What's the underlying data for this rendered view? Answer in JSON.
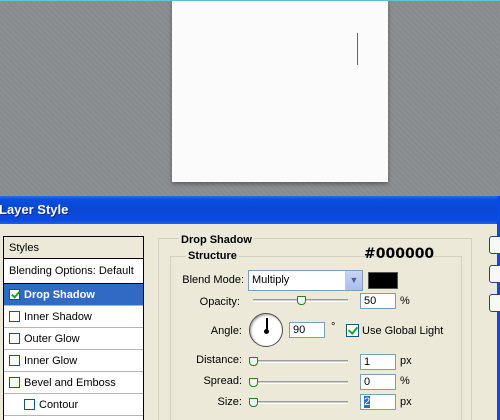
{
  "window": {
    "title": "Layer Style"
  },
  "styles": {
    "header": "Styles",
    "items": [
      {
        "label": "Blending Options: Default",
        "checkbox": false,
        "checked": false,
        "selected": false
      },
      {
        "label": "Drop Shadow",
        "checkbox": true,
        "checked": true,
        "selected": true
      },
      {
        "label": "Inner Shadow",
        "checkbox": true,
        "checked": false,
        "selected": false
      },
      {
        "label": "Outer Glow",
        "checkbox": true,
        "checked": false,
        "selected": false
      },
      {
        "label": "Inner Glow",
        "checkbox": true,
        "checked": false,
        "selected": false
      },
      {
        "label": "Bevel and Emboss",
        "checkbox": true,
        "checked": false,
        "selected": false
      },
      {
        "label": "Contour",
        "checkbox": true,
        "checked": false,
        "selected": false,
        "sub": true
      }
    ]
  },
  "drop_shadow": {
    "group_title": "Drop Shadow",
    "structure_title": "Structure",
    "annotation": "#000000",
    "blend_mode": {
      "label": "Blend Mode:",
      "value": "Multiply"
    },
    "color": "#000000",
    "opacity": {
      "label": "Opacity:",
      "value": "50",
      "unit": "%",
      "level": 0.5
    },
    "angle": {
      "label": "Angle:",
      "value": "90",
      "unit": "°",
      "global_light_label": "Use Global Light",
      "global_light": true
    },
    "distance": {
      "label": "Distance:",
      "value": "1",
      "unit": "px",
      "level": 0.0
    },
    "spread": {
      "label": "Spread:",
      "value": "0",
      "unit": "%",
      "level": 0.0
    },
    "size": {
      "label": "Size:",
      "value": "2",
      "unit": "px",
      "level": 0.0
    }
  },
  "colors": {
    "accent": "#316ac5",
    "titlebar": "#0a4be0",
    "panel": "#ece9d8"
  }
}
